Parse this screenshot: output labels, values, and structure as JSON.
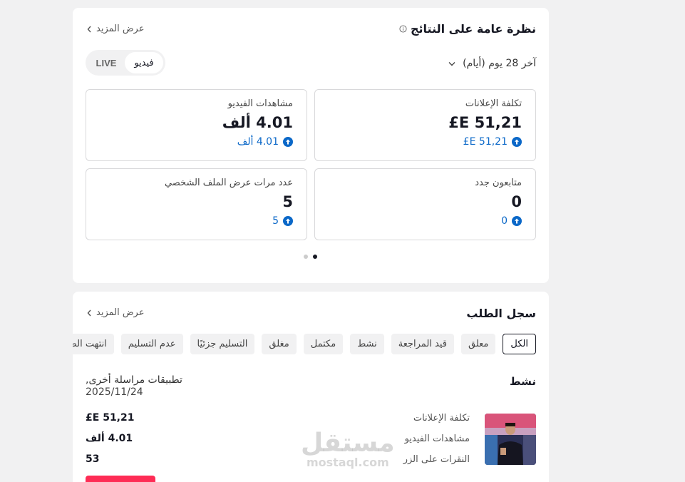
{
  "overview": {
    "title": "نظرة عامة على النتائج",
    "see_more": "عرض المزيد",
    "period": "آخر 28 يوم (أيام)",
    "toggle": {
      "live": "LIVE",
      "video": "فيديو",
      "selected": "فيديو"
    },
    "metrics": [
      {
        "label": "تكلفة الإعلانات",
        "value": "51,21 E£",
        "change": "51,21 E£"
      },
      {
        "label": "مشاهدات الفيديو",
        "value": "4.01 ألف",
        "change": "4.01 ألف"
      },
      {
        "label": "متابعون جدد",
        "value": "0",
        "change": "0"
      },
      {
        "label": "عدد مرات عرض الملف الشخصي",
        "value": "5",
        "change": "5"
      }
    ],
    "pagination": {
      "pages": 2,
      "current": 2
    }
  },
  "orders": {
    "title": "سجل الطلب",
    "see_more": "عرض المزيد",
    "filters": [
      "الكل",
      "معلق",
      "قيد المراجعة",
      "نشط",
      "مكتمل",
      "مغلق",
      "التسليم جزئيًا",
      "عدم التسليم",
      "انتهت الصلاحية"
    ],
    "active_filter": "الكل",
    "order": {
      "status": "نشط",
      "description": "تطبيقات مراسلة أخرى,",
      "date": "2025/11/24",
      "rows": [
        {
          "label": "تكلفة الإعلانات",
          "value": "51,21 E£"
        },
        {
          "label": "مشاهدات الفيديو",
          "value": "4.01 ألف"
        },
        {
          "label": "النقرات على الزر",
          "value": "53"
        }
      ]
    }
  },
  "watermark": {
    "arabic": "مستقل",
    "latin": "mostaql.com"
  },
  "colors": {
    "accent_blue": "#0b68c8",
    "primary_red": "#fe2c55",
    "text": "#161823"
  },
  "icons": {
    "info": "info-icon",
    "see_more": "chevron-left-icon",
    "period": "chevron-down-icon",
    "change": "arrow-up-circle-icon"
  }
}
